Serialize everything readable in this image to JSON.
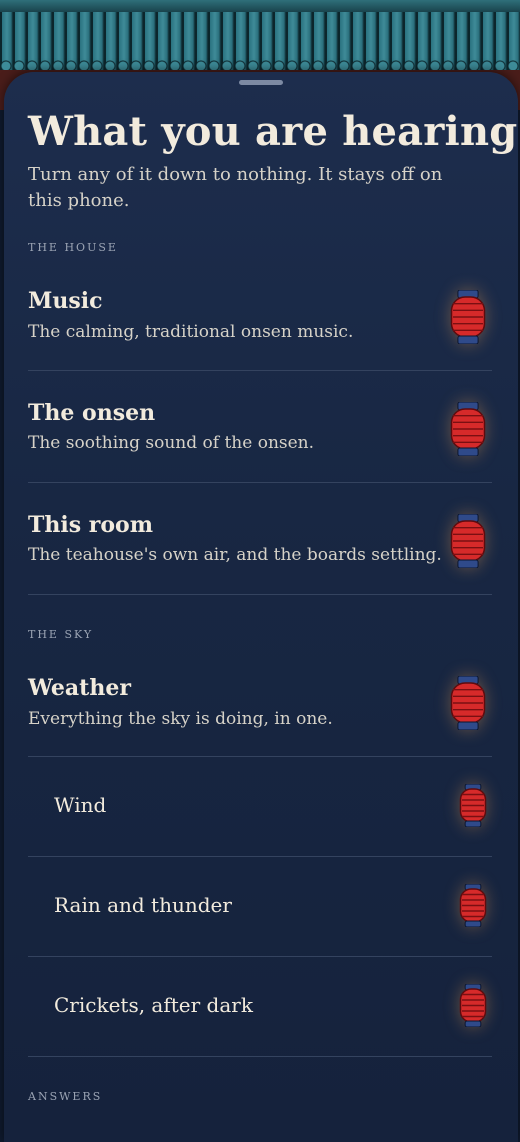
{
  "sheet": {
    "title": "What you are hearing",
    "subtitle": "Turn any of it down to nothing. It stays off on this phone."
  },
  "sections": {
    "house": {
      "label": "THE HOUSE",
      "items": [
        {
          "title": "Music",
          "description": "The calming, traditional onsen music.",
          "state": "on"
        },
        {
          "title": "The onsen",
          "description": "The soothing sound of the onsen.",
          "state": "on"
        },
        {
          "title": "This room",
          "description": "The teahouse's own air, and the boards settling.",
          "state": "on"
        }
      ]
    },
    "sky": {
      "label": "THE SKY",
      "main": {
        "title": "Weather",
        "description": "Everything the sky is doing, in one.",
        "state": "on"
      },
      "subitems": [
        {
          "label": "Wind",
          "state": "on"
        },
        {
          "label": "Rain and thunder",
          "state": "on"
        },
        {
          "label": "Crickets, after dark",
          "state": "on"
        }
      ]
    },
    "answers": {
      "label": "ANSWERS"
    }
  },
  "icons": {
    "toggle": "paper-lantern-icon",
    "grabber": "sheet-grabber"
  },
  "colors": {
    "background": "#182743",
    "text_primary": "#f2ebdd",
    "text_secondary": "#d6d2c8",
    "section_label": "#9aa3b3",
    "lantern_red": "#d62a2a",
    "lantern_cap": "#2f4a8a",
    "divider": "#34435f"
  }
}
